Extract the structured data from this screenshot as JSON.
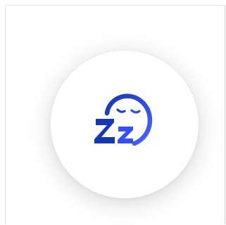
{
  "icon": {
    "name": "sleeping-face-zz-icon",
    "gradient_start": "#1637b7",
    "gradient_end": "#4a63ff"
  },
  "colors": {
    "background": "#ffffff",
    "frame_border": "#e2e2e2",
    "circle": "#ffffff"
  }
}
